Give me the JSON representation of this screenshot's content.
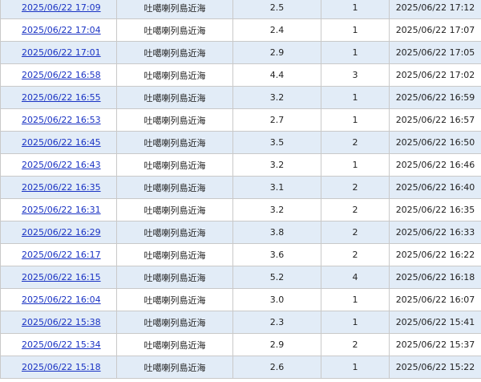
{
  "rows": [
    {
      "time": "2025/06/22 17:09",
      "location": "吐噶喇列島近海",
      "magnitude": "2.5",
      "intensity": "1",
      "announced": "2025/06/22 17:12"
    },
    {
      "time": "2025/06/22 17:04",
      "location": "吐噶喇列島近海",
      "magnitude": "2.4",
      "intensity": "1",
      "announced": "2025/06/22 17:07"
    },
    {
      "time": "2025/06/22 17:01",
      "location": "吐噶喇列島近海",
      "magnitude": "2.9",
      "intensity": "1",
      "announced": "2025/06/22 17:05"
    },
    {
      "time": "2025/06/22 16:58",
      "location": "吐噶喇列島近海",
      "magnitude": "4.4",
      "intensity": "3",
      "announced": "2025/06/22 17:02"
    },
    {
      "time": "2025/06/22 16:55",
      "location": "吐噶喇列島近海",
      "magnitude": "3.2",
      "intensity": "1",
      "announced": "2025/06/22 16:59"
    },
    {
      "time": "2025/06/22 16:53",
      "location": "吐噶喇列島近海",
      "magnitude": "2.7",
      "intensity": "1",
      "announced": "2025/06/22 16:57"
    },
    {
      "time": "2025/06/22 16:45",
      "location": "吐噶喇列島近海",
      "magnitude": "3.5",
      "intensity": "2",
      "announced": "2025/06/22 16:50"
    },
    {
      "time": "2025/06/22 16:43",
      "location": "吐噶喇列島近海",
      "magnitude": "3.2",
      "intensity": "1",
      "announced": "2025/06/22 16:46"
    },
    {
      "time": "2025/06/22 16:35",
      "location": "吐噶喇列島近海",
      "magnitude": "3.1",
      "intensity": "2",
      "announced": "2025/06/22 16:40"
    },
    {
      "time": "2025/06/22 16:31",
      "location": "吐噶喇列島近海",
      "magnitude": "3.2",
      "intensity": "2",
      "announced": "2025/06/22 16:35"
    },
    {
      "time": "2025/06/22 16:29",
      "location": "吐噶喇列島近海",
      "magnitude": "3.8",
      "intensity": "2",
      "announced": "2025/06/22 16:33"
    },
    {
      "time": "2025/06/22 16:17",
      "location": "吐噶喇列島近海",
      "magnitude": "3.6",
      "intensity": "2",
      "announced": "2025/06/22 16:22"
    },
    {
      "time": "2025/06/22 16:15",
      "location": "吐噶喇列島近海",
      "magnitude": "5.2",
      "intensity": "4",
      "announced": "2025/06/22 16:18"
    },
    {
      "time": "2025/06/22 16:04",
      "location": "吐噶喇列島近海",
      "magnitude": "3.0",
      "intensity": "1",
      "announced": "2025/06/22 16:07"
    },
    {
      "time": "2025/06/22 15:38",
      "location": "吐噶喇列島近海",
      "magnitude": "2.3",
      "intensity": "1",
      "announced": "2025/06/22 15:41"
    },
    {
      "time": "2025/06/22 15:34",
      "location": "吐噶喇列島近海",
      "magnitude": "2.9",
      "intensity": "2",
      "announced": "2025/06/22 15:37"
    },
    {
      "time": "2025/06/22 15:18",
      "location": "吐噶喇列島近海",
      "magnitude": "2.6",
      "intensity": "1",
      "announced": "2025/06/22 15:22"
    }
  ]
}
